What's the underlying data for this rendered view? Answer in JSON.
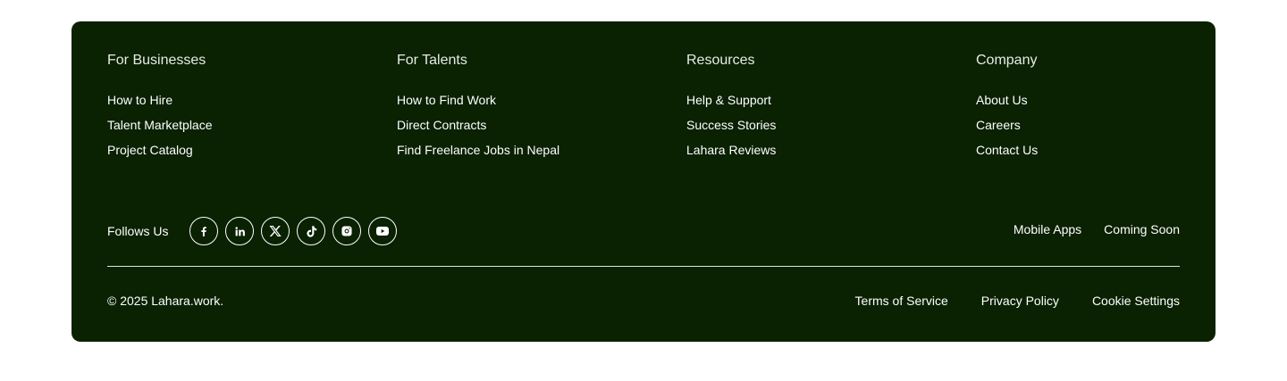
{
  "colors": {
    "background": "#0a2102",
    "text": "#ffffff"
  },
  "columns": [
    {
      "title": "For Businesses",
      "links": [
        "How to Hire",
        "Talent Marketplace",
        "Project Catalog"
      ]
    },
    {
      "title": "For Talents",
      "links": [
        "How to Find Work",
        "Direct Contracts",
        "Find Freelance Jobs in Nepal"
      ]
    },
    {
      "title": "Resources",
      "links": [
        "Help & Support",
        "Success Stories",
        "Lahara Reviews"
      ]
    },
    {
      "title": "Company",
      "links": [
        "About Us",
        "Careers",
        "Contact Us"
      ]
    }
  ],
  "follow": {
    "label": "Follows Us",
    "icons": [
      "facebook-icon",
      "linkedin-icon",
      "x-twitter-icon",
      "tiktok-icon",
      "instagram-icon",
      "youtube-icon"
    ]
  },
  "mobile": {
    "label": "Mobile Apps",
    "status": "Coming Soon"
  },
  "copyright": "© 2025 Lahara.work.",
  "legal": [
    "Terms of Service",
    "Privacy Policy",
    "Cookie Settings"
  ]
}
